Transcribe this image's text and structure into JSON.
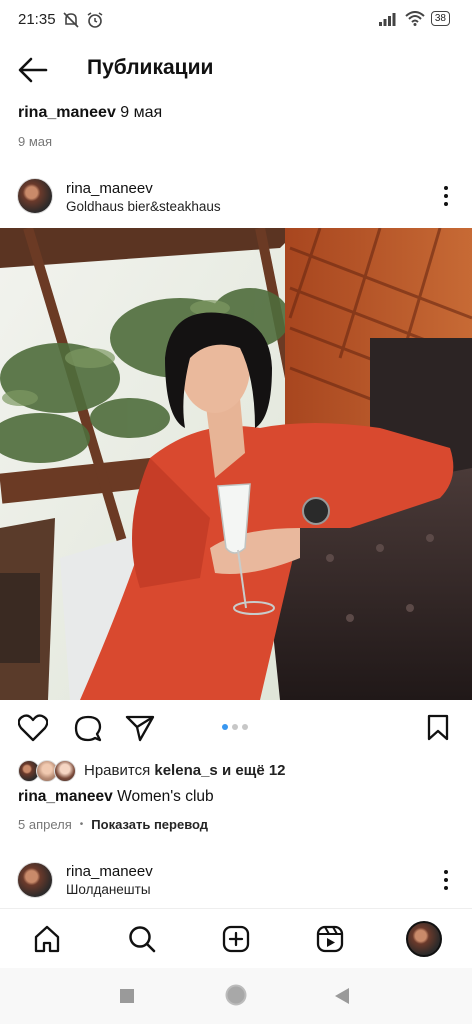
{
  "status_bar": {
    "time": "21:35",
    "battery": "38"
  },
  "header": {
    "title": "Публикации"
  },
  "repost": {
    "username": "rina_maneev",
    "date": "9 мая",
    "date_line": "9 мая"
  },
  "post": {
    "username": "rina_maneev",
    "location": "Goldhaus bier&steakhaus",
    "carousel": {
      "count": 3,
      "active_index": 0
    },
    "likes_prefix": "Нравится",
    "likes_user": "kelena_s",
    "likes_suffix": "и ещё 12",
    "caption_user": "rina_maneev",
    "caption_text": "Women's club",
    "date": "5 апреля",
    "translate_label": "Показать перевод"
  },
  "next_post": {
    "username": "rina_maneev",
    "location": "Шолданешты"
  },
  "icons": {
    "back": "arrow-left-icon",
    "more": "more-vertical-icon",
    "like": "heart-icon",
    "comment": "comment-icon",
    "share": "send-icon",
    "save": "bookmark-icon",
    "nav": [
      "home-icon",
      "search-icon",
      "add-icon",
      "reels-icon",
      "profile-avatar"
    ]
  },
  "colors": {
    "accent": "#3897f0",
    "dress": "#d9492f"
  }
}
